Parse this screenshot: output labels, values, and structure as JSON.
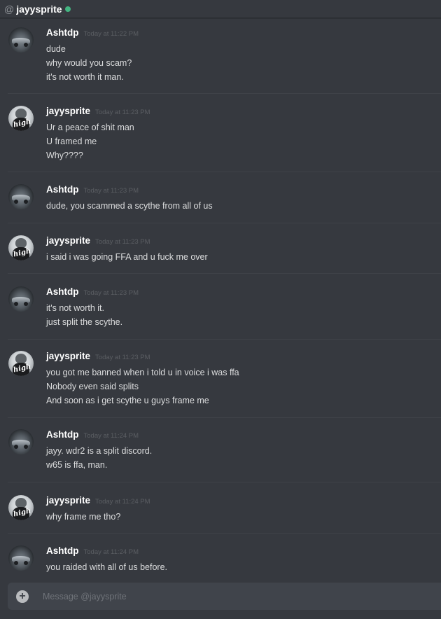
{
  "header": {
    "at_symbol": "@",
    "title": "jayysprite",
    "status": "online"
  },
  "colors": {
    "background": "#36393f",
    "header_text": "#ffffff",
    "timestamp": "#5b5e63",
    "online": "#43b581",
    "composer_bg": "#40444b"
  },
  "messages": [
    {
      "author": "Ashtdp",
      "timestamp": "Today at 11:22 PM",
      "lines": [
        "dude",
        "why would you scam?",
        "it's not worth it man."
      ]
    },
    {
      "author": "jayysprite",
      "timestamp": "Today at 11:23 PM",
      "lines": [
        "Ur a peace of shit man",
        "U framed me",
        "Why????"
      ]
    },
    {
      "author": "Ashtdp",
      "timestamp": "Today at 11:23 PM",
      "lines": [
        "dude, you scammed a scythe from all of us"
      ]
    },
    {
      "author": "jayysprite",
      "timestamp": "Today at 11:23 PM",
      "lines": [
        "i said i was going FFA and u fuck me over"
      ]
    },
    {
      "author": "Ashtdp",
      "timestamp": "Today at 11:23 PM",
      "lines": [
        "it's not worth it.",
        "just split the scythe."
      ]
    },
    {
      "author": "jayysprite",
      "timestamp": "Today at 11:23 PM",
      "lines": [
        "you got me banned when i told u in voice i was ffa",
        "Nobody even said splits",
        "And soon as i get scythe u guys frame me"
      ]
    },
    {
      "author": "Ashtdp",
      "timestamp": "Today at 11:24 PM",
      "lines": [
        "jayy. wdr2 is a split discord.",
        "w65 is ffa, man."
      ]
    },
    {
      "author": "jayysprite",
      "timestamp": "Today at 11:24 PM",
      "lines": [
        "why frame me tho?"
      ]
    },
    {
      "author": "Ashtdp",
      "timestamp": "Today at 11:24 PM",
      "lines": [
        "you raided with all of us before."
      ]
    }
  ],
  "avatars": {
    "Ashtdp": {
      "icon": "car-avatar-icon",
      "high_text": ""
    },
    "jayysprite": {
      "icon": "high-avatar-icon",
      "high_text": "high"
    }
  },
  "composer": {
    "icon": "plus-circle-icon",
    "placeholder": "Message @jayysprite"
  }
}
